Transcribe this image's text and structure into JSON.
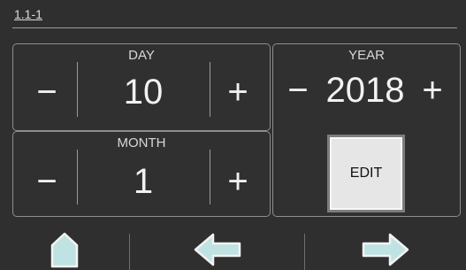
{
  "header": {
    "screen_id": "1.1-1"
  },
  "day": {
    "label": "DAY",
    "value": "10",
    "decrement_glyph": "−",
    "increment_glyph": "+"
  },
  "month": {
    "label": "MONTH",
    "value": "1",
    "decrement_glyph": "−",
    "increment_glyph": "+"
  },
  "year": {
    "label": "YEAR",
    "value": "2018",
    "decrement_glyph": "−",
    "increment_glyph": "+"
  },
  "edit": {
    "label": "EDIT"
  },
  "nav": {
    "home_icon": "home-icon",
    "back_icon": "arrow-left-icon",
    "forward_icon": "arrow-right-icon",
    "icon_fill": "#bfe3e2"
  }
}
